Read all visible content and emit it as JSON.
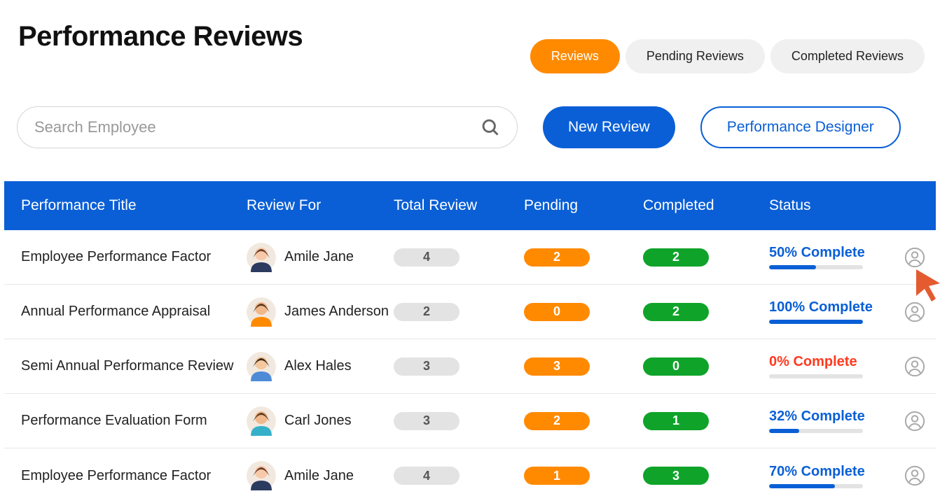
{
  "page": {
    "title": "Performance Reviews"
  },
  "tabs": [
    {
      "label": "Reviews",
      "active": true
    },
    {
      "label": "Pending Reviews",
      "active": false
    },
    {
      "label": "Completed Reviews",
      "active": false
    }
  ],
  "search": {
    "placeholder": "Search Employee"
  },
  "buttons": {
    "new_review": "New Review",
    "performance_designer": "Performance Designer"
  },
  "table": {
    "headers": [
      "Performance Title",
      "Review For",
      "Total Review",
      "Pending",
      "Completed",
      "Status"
    ],
    "rows": [
      {
        "title": "Employee Performance Factor",
        "employee": "Amile Jane",
        "avatar": "f1",
        "total": "4",
        "pending": "2",
        "completed": "2",
        "status_text": "50% Complete",
        "status_pct": 50,
        "status_color": "blue"
      },
      {
        "title": "Annual Performance Appraisal",
        "employee": "James Anderson",
        "avatar": "m1",
        "total": "2",
        "pending": "0",
        "completed": "2",
        "status_text": "100% Complete",
        "status_pct": 100,
        "status_color": "blue"
      },
      {
        "title": "Semi Annual Performance Review",
        "employee": "Alex Hales",
        "avatar": "m2",
        "total": "3",
        "pending": "3",
        "completed": "0",
        "status_text": "0% Complete",
        "status_pct": 0,
        "status_color": "red"
      },
      {
        "title": "Performance Evaluation Form",
        "employee": "Carl Jones",
        "avatar": "m3",
        "total": "3",
        "pending": "2",
        "completed": "1",
        "status_text": "32% Complete",
        "status_pct": 32,
        "status_color": "blue"
      },
      {
        "title": "Employee Performance Factor",
        "employee": "Amile Jane",
        "avatar": "f1",
        "total": "4",
        "pending": "1",
        "completed": "3",
        "status_text": "70% Complete",
        "status_pct": 70,
        "status_color": "blue"
      }
    ]
  },
  "avatar_colors": {
    "f1": {
      "skin": "#f7c9a8",
      "hair": "#6b3e2e",
      "shirt": "#2b3a5f"
    },
    "m1": {
      "skin": "#f0b88c",
      "hair": "#5a3a22",
      "shirt": "#ff8a00"
    },
    "m2": {
      "skin": "#f4c79e",
      "hair": "#3b2a1a",
      "shirt": "#4e8bd6"
    },
    "m3": {
      "skin": "#f0b88c",
      "hair": "#5a3a22",
      "shirt": "#36b0c9"
    }
  }
}
